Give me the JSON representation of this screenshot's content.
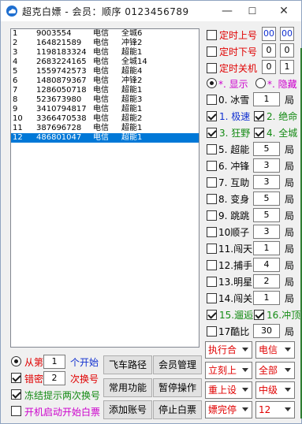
{
  "window": {
    "title": "超克白嫖 - 会员：顺序 0123456789",
    "minimize_label": "—",
    "maximize_label": "☐",
    "close_label": "✕",
    "icon": "cloud-app-icon"
  },
  "list": {
    "rows": [
      {
        "idx": "1",
        "num": "9003554",
        "carrier": "电信",
        "tag": "全城6"
      },
      {
        "idx": "2",
        "num": "164821589",
        "carrier": "电信",
        "tag": "冲锋2"
      },
      {
        "idx": "3",
        "num": "1198183324",
        "carrier": "电信",
        "tag": "超能1"
      },
      {
        "idx": "4",
        "num": "2683224165",
        "carrier": "电信",
        "tag": "全城14"
      },
      {
        "idx": "5",
        "num": "1559742573",
        "carrier": "电信",
        "tag": "超能4"
      },
      {
        "idx": "6",
        "num": "1480879367",
        "carrier": "电信",
        "tag": "冲锋2"
      },
      {
        "idx": "7",
        "num": "1286050718",
        "carrier": "电信",
        "tag": "超能1"
      },
      {
        "idx": "8",
        "num": "523673980",
        "carrier": "电信",
        "tag": "超能3"
      },
      {
        "idx": "9",
        "num": "3410794817",
        "carrier": "电信",
        "tag": "超能1"
      },
      {
        "idx": "10",
        "num": "3366470538",
        "carrier": "电信",
        "tag": "超能2"
      },
      {
        "idx": "11",
        "num": "387696728",
        "carrier": "电信",
        "tag": "超能1"
      },
      {
        "idx": "12",
        "num": "486801047",
        "carrier": "电信",
        "tag": "超能1"
      }
    ],
    "selected_index": 11
  },
  "bottom_left": {
    "from_label": "从第",
    "from_value": "1",
    "from_suffix": "个开始",
    "wrong_pwd_label": "错密",
    "wrong_pwd_value": "2",
    "wrong_pwd_suffix": "次换号",
    "freeze_label": "冻结提示两次换号",
    "autostart_label": "开机启动开始白票"
  },
  "buttons": {
    "fly_path": "飞车路径",
    "member_mgmt": "会员管理",
    "common_func": "常用功能",
    "pause_op": "暂停操作",
    "add_account": "添加账号",
    "stop_free": "停止白票"
  },
  "right": {
    "timer_on_label": "定时上号",
    "timer_on_h": "00",
    "timer_on_m": "00",
    "timer_off_label": "定时下号",
    "timer_off_h": "0",
    "timer_off_m": "0",
    "timer_shutdown_label": "定时关机",
    "timer_shutdown_h": "0",
    "timer_shutdown_m": "1",
    "show_label": "*. 显示",
    "hide_label": "*. 隐藏",
    "modes": [
      {
        "label": "0. 冰雪",
        "value": "1",
        "unit": "局",
        "checked": false
      },
      {
        "label": "5. 超能",
        "value": "5",
        "unit": "局",
        "checked": false
      },
      {
        "label": "6. 冲锋",
        "value": "3",
        "unit": "局",
        "checked": false
      },
      {
        "label": "7. 互助",
        "value": "3",
        "unit": "局",
        "checked": false
      },
      {
        "label": "8. 变身",
        "value": "5",
        "unit": "局",
        "checked": false
      },
      {
        "label": "9. 跳跳",
        "value": "5",
        "unit": "局",
        "checked": false
      },
      {
        "label": "10顺子",
        "value": "3",
        "unit": "局",
        "checked": false
      },
      {
        "label": "11.闯天",
        "value": "1",
        "unit": "局",
        "checked": false
      },
      {
        "label": "12.捕手",
        "value": "4",
        "unit": "局",
        "checked": false
      },
      {
        "label": "13.明星",
        "value": "2",
        "unit": "局",
        "checked": false
      },
      {
        "label": "14.闯关",
        "value": "1",
        "unit": "局",
        "checked": false
      },
      {
        "label": "17酷比",
        "value": "30",
        "unit": "局",
        "checked": false
      }
    ],
    "pair1_a": "1. 极速",
    "pair1_b": "2. 绝命",
    "pair2_a": "3. 狂野",
    "pair2_b": "4. 全城",
    "pair3_a": "15.遛逅",
    "pair3_b": "16.冲顶",
    "dd_exec": "执行合",
    "dd_carrier": "电信",
    "dd_onup": "立刻上",
    "dd_all": "全部",
    "dd_reset": "重上设",
    "dd_level": "中级",
    "dd_finish": "嫖完停",
    "dd_count": "12"
  },
  "colors": {
    "red": "#e00000",
    "green": "#138a13",
    "blue": "#1030d0",
    "magenta": "#cc00cc",
    "selection": "#0078d7"
  }
}
